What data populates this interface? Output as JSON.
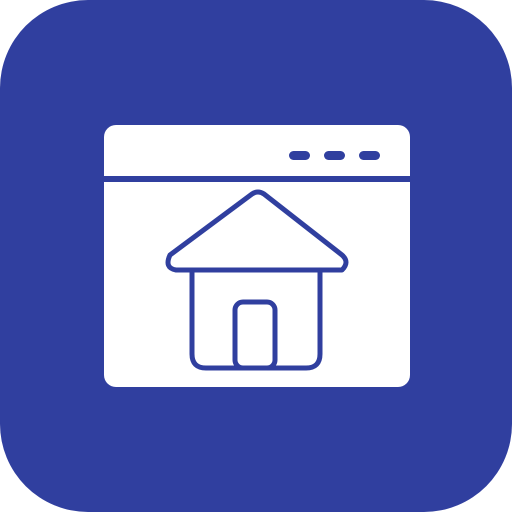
{
  "icon": {
    "name": "browser-homepage-icon",
    "background_color": "#303F9F",
    "foreground_color": "#FFFFFF",
    "window_controls": [
      "dot",
      "dot",
      "dot"
    ]
  }
}
